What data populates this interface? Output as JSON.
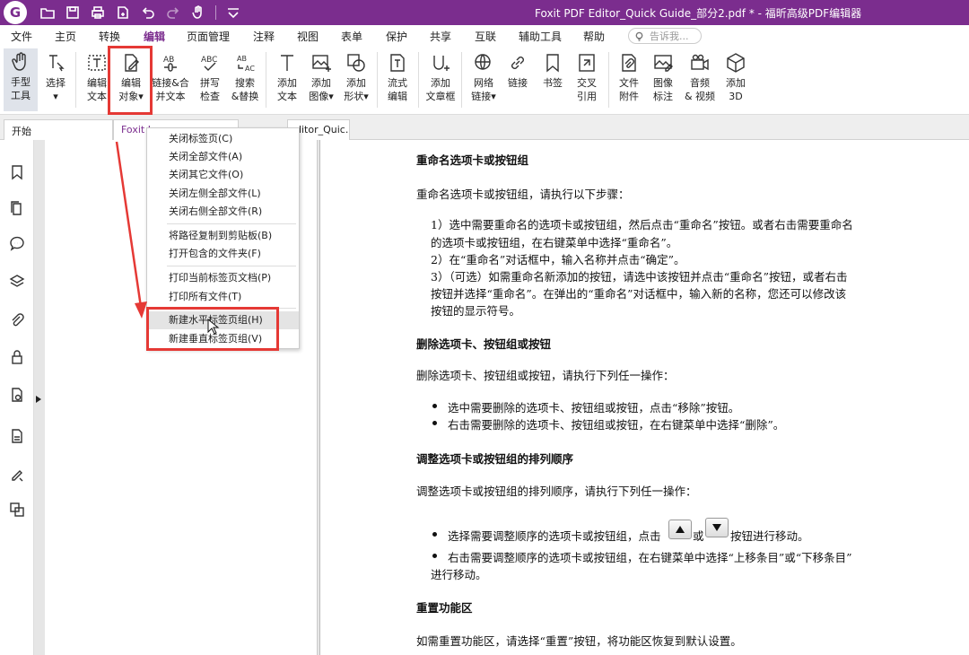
{
  "titlebar": {
    "logo": "G",
    "title": "Foxit PDF Editor_Quick Guide_部分2.pdf * - 福昕高级PDF编辑器"
  },
  "menu": {
    "items": [
      "文件",
      "主页",
      "转换",
      "编辑",
      "页面管理",
      "注释",
      "视图",
      "表单",
      "保护",
      "共享",
      "互联",
      "辅助工具",
      "帮助"
    ],
    "active": "编辑",
    "tellme_placeholder": "告诉我..."
  },
  "ribbon": {
    "hand": [
      "手型",
      "工具"
    ],
    "select": [
      "选择",
      "▾"
    ],
    "edit_text": [
      "编辑",
      "文本"
    ],
    "edit_object": [
      "编辑",
      "对象▾"
    ],
    "link_merge": [
      "链接&合",
      "并文本"
    ],
    "spell": [
      "拼写",
      "检查"
    ],
    "search_replace": [
      "搜索",
      "&替换"
    ],
    "add_text": [
      "添加",
      "文本"
    ],
    "add_image": [
      "添加",
      "图像▾"
    ],
    "add_shape": [
      "添加",
      "形状▾"
    ],
    "flow_edit": [
      "流式",
      "编辑"
    ],
    "add_textbox": [
      "添加",
      "文章框"
    ],
    "web_link": [
      "网络",
      "链接▾"
    ],
    "link": [
      "链接"
    ],
    "bookmark": [
      "书签"
    ],
    "cross_ref": [
      "交叉",
      "引用"
    ],
    "file_attach": [
      "文件",
      "附件"
    ],
    "image_note": [
      "图像",
      "标注"
    ],
    "audio_video": [
      "音频",
      "& 视频"
    ],
    "add_3d": [
      "添加",
      "3D"
    ]
  },
  "tabs": {
    "start": "开始",
    "foxit": "Foxit I",
    "third": "ditor_Quic..."
  },
  "context_menu": [
    "关闭标签页(C)",
    "关闭全部文件(A)",
    "关闭其它文件(O)",
    "关闭左侧全部文件(L)",
    "关闭右侧全部文件(R)",
    "将路径复制到剪贴板(B)",
    "打开包含的文件夹(F)",
    "打印当前标签页文档(P)",
    "打印所有文件(T)",
    "新建水平标签页组(H)",
    "新建垂直标签页组(V)"
  ],
  "document": {
    "h1": "重命名选项卡或按钮组",
    "p1": "重命名选项卡或按钮组，请执行以下步骤：",
    "s1a": "1）选中需要重命名的选项卡或按钮组，然后点击“重命名”按钮。或者右击需要重命名",
    "s1b": "的选项卡或按钮组，在右键菜单中选择“重命名”。",
    "s2": "2）在“重命名”对话框中，输入名称并点击“确定”。",
    "s3a": "3）（可选）如需重命名新添加的按钮，请选中该按钮并点击“重命名”按钮，或者右击",
    "s3b": "按钮并选择“重命名”。在弹出的“重命名”对话框中，输入新的名称，您还可以修改该",
    "s3c": "按钮的显示符号。",
    "h2": "删除选项卡、按钮组或按钮",
    "p2": "删除选项卡、按钮组或按钮，请执行下列任一操作：",
    "b2a": "选中需要删除的选项卡、按钮组或按钮，点击“移除”按钮。",
    "b2b": "右击需要删除的选项卡、按钮组或按钮，在右键菜单中选择“删除”。",
    "h3": "调整选项卡或按钮组的排列顺序",
    "p3": "调整选项卡或按钮组的排列顺序，请执行下列任一操作：",
    "b3a_1": "选择需要调整顺序的选项卡或按钮组，点击",
    "b3a_2": "或",
    "b3a_3": "按钮进行移动。",
    "b3b_1": "右击需要调整顺序的选项卡或按钮组，在右键菜单中选择“上移条目”或“下移条目”",
    "b3b_2": "进行移动。",
    "h4": "重置功能区",
    "p4": "如需重置功能区，请选择“重置”按钮，将功能区恢复到默认设置。"
  },
  "colors": {
    "brand": "#7b2d8e",
    "highlight": "#e53935"
  }
}
